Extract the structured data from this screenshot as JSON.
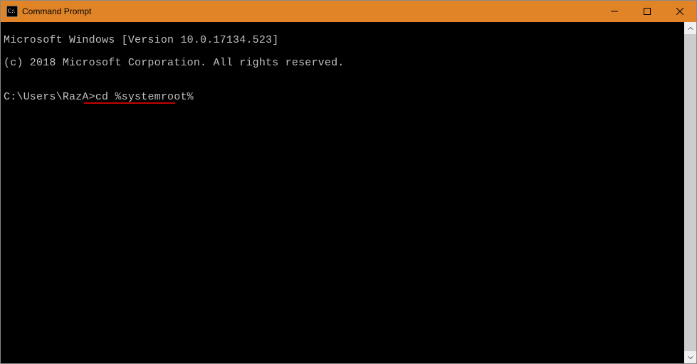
{
  "window": {
    "title": "Command Prompt",
    "icon_name": "cmd-icon"
  },
  "terminal": {
    "lines": [
      "Microsoft Windows [Version 10.0.17134.523]",
      "(c) 2018 Microsoft Corporation. All rights reserved.",
      "",
      ""
    ],
    "prompt": "C:\\Users\\RazA>",
    "command": "cd %systemroot%",
    "annotation": {
      "type": "red-underline",
      "target": "cd %systemroot%"
    }
  },
  "colors": {
    "titlebar_bg": "#e08427",
    "terminal_bg": "#000000",
    "terminal_fg": "#c0c0c0",
    "annotation": "#c00000"
  }
}
